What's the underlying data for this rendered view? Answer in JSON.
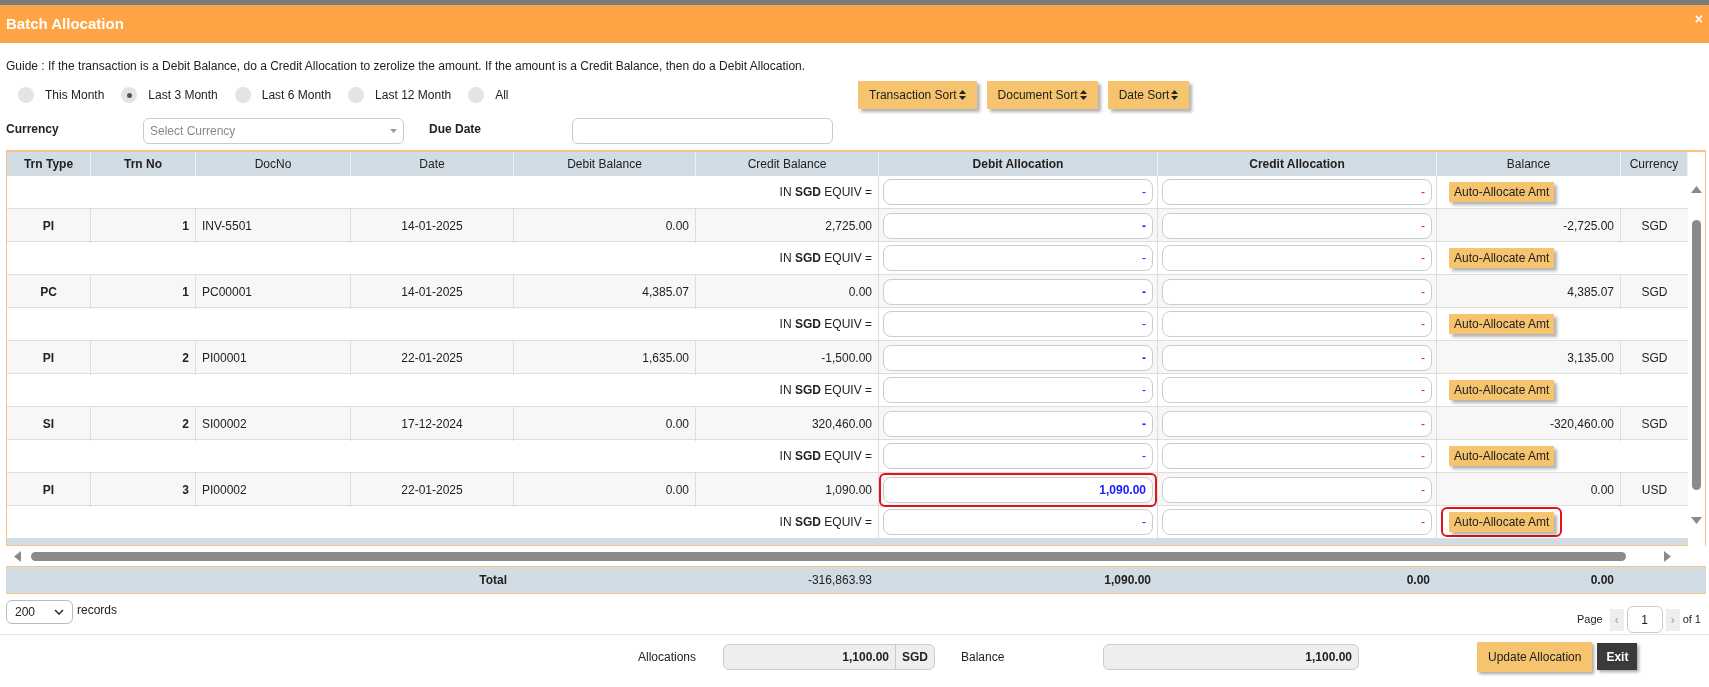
{
  "window": {
    "title": "Batch Allocation",
    "close": "×"
  },
  "guide": "Guide : If the transaction is a Debit Balance, do a Credit Allocation to zerolize the amount. If the amount is a Credit Balance, then do a Debit Allocation.",
  "period_options": [
    {
      "label": "This Month",
      "selected": false
    },
    {
      "label": "Last 3 Month",
      "selected": true
    },
    {
      "label": "Last 6 Month",
      "selected": false
    },
    {
      "label": "Last 12 Month",
      "selected": false
    },
    {
      "label": "All",
      "selected": false
    }
  ],
  "sort_buttons": [
    "Transaction Sort",
    "Document Sort",
    "Date Sort"
  ],
  "currency": {
    "label": "Currency",
    "placeholder": "Select Currency"
  },
  "due_date": {
    "label": "Due Date"
  },
  "table": {
    "columns": [
      "Trn Type",
      "Trn No",
      "DocNo",
      "Date",
      "Debit Balance",
      "Credit Balance",
      "Debit Allocation",
      "Credit Allocation",
      "Balance",
      "Currency"
    ],
    "rows": [
      {
        "kind": "equiv",
        "label": "IN **SGD** EQUIV =",
        "debit_allocation": "-",
        "credit_allocation": "-",
        "button": "Auto-Allocate Amt",
        "highlighted": false
      },
      {
        "kind": "transaction",
        "trn_type": "PI",
        "trn_no": "1",
        "doc_no": "INV-5501",
        "date": "14-01-2025",
        "debit_balance": "0.00",
        "credit_balance": "2,725.00",
        "debit_allocation": "-",
        "credit_allocation": "-",
        "balance": "-2,725.00",
        "currency": "SGD",
        "highlighted": false
      },
      {
        "kind": "equiv",
        "label": "IN **SGD** EQUIV =",
        "debit_allocation": "-",
        "credit_allocation": "-",
        "button": "Auto-Allocate Amt",
        "highlighted": false
      },
      {
        "kind": "transaction",
        "trn_type": "PC",
        "trn_no": "1",
        "doc_no": "PC00001",
        "date": "14-01-2025",
        "debit_balance": "4,385.07",
        "credit_balance": "0.00",
        "debit_allocation": "-",
        "credit_allocation": "-",
        "balance": "4,385.07",
        "currency": "SGD",
        "highlighted": false
      },
      {
        "kind": "equiv",
        "label": "IN **SGD** EQUIV =",
        "debit_allocation": "-",
        "credit_allocation": "-",
        "button": "Auto-Allocate Amt",
        "highlighted": false
      },
      {
        "kind": "transaction",
        "trn_type": "PI",
        "trn_no": "2",
        "doc_no": "PI00001",
        "date": "22-01-2025",
        "debit_balance": "1,635.00",
        "credit_balance": "-1,500.00",
        "debit_allocation": "-",
        "credit_allocation": "-",
        "balance": "3,135.00",
        "currency": "SGD",
        "highlighted": false
      },
      {
        "kind": "equiv",
        "label": "IN **SGD** EQUIV =",
        "debit_allocation": "-",
        "credit_allocation": "-",
        "button": "Auto-Allocate Amt",
        "highlighted": false
      },
      {
        "kind": "transaction",
        "trn_type": "SI",
        "trn_no": "2",
        "doc_no": "SI00002",
        "date": "17-12-2024",
        "debit_balance": "0.00",
        "credit_balance": "320,460.00",
        "debit_allocation": "-",
        "credit_allocation": "-",
        "balance": "-320,460.00",
        "currency": "SGD",
        "highlighted": false
      },
      {
        "kind": "equiv",
        "label": "IN **SGD** EQUIV =",
        "debit_allocation": "-",
        "credit_allocation": "-",
        "button": "Auto-Allocate Amt",
        "highlighted": false
      },
      {
        "kind": "transaction",
        "trn_type": "PI",
        "trn_no": "3",
        "doc_no": "PI00002",
        "date": "22-01-2025",
        "debit_balance": "0.00",
        "credit_balance": "1,090.00",
        "debit_allocation": "1,090.00",
        "credit_allocation": "-",
        "balance": "0.00",
        "currency": "USD",
        "highlighted": true
      },
      {
        "kind": "equiv",
        "label": "IN **SGD** EQUIV =",
        "debit_allocation": "-",
        "credit_allocation": "-",
        "button": "Auto-Allocate Amt",
        "highlighted": true
      }
    ],
    "totals": {
      "label": "Total",
      "credit_balance": "-316,863.93",
      "debit_allocation": "1,090.00",
      "credit_allocation": "0.00",
      "balance": "0.00"
    }
  },
  "pager": {
    "page_size": "200",
    "records_label": "records",
    "page_label": "Page",
    "prev": "‹",
    "page": "1",
    "next": "›",
    "of": "of 1"
  },
  "footer": {
    "allocations_label": "Allocations",
    "allocations": "1,100.00",
    "currency": "SGD",
    "balance_label": "Balance",
    "balance": "1,100.00",
    "update_button": "Update Allocation",
    "exit_button": "Exit"
  }
}
